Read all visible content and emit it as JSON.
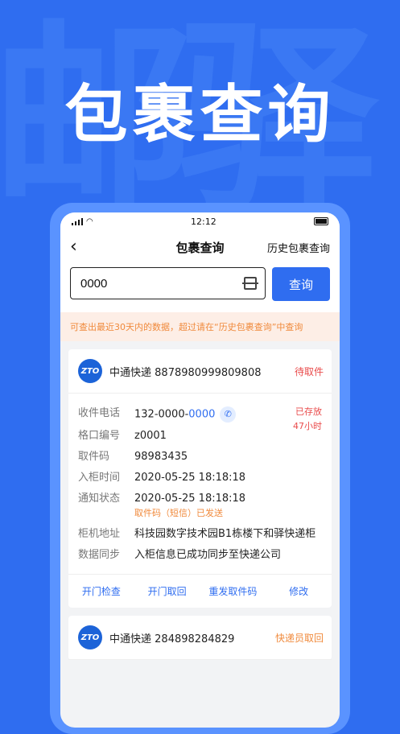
{
  "background": {
    "watermark": "邮驿",
    "hero_title": "包裹查询"
  },
  "status_bar": {
    "time": "12:12"
  },
  "nav": {
    "title": "包裹查询",
    "history_link": "历史包裹查询"
  },
  "search": {
    "value": "0000",
    "button_label": "查询"
  },
  "notice": "可查出最近30天内的数据，超过请在“历史包裹查询”中查询",
  "cards": [
    {
      "carrier": "中通快递",
      "tracking": "8878980999809808",
      "status": "待取件",
      "stored_label": "已存放",
      "stored_duration": "47小时",
      "rows": {
        "phone_label": "收件电话",
        "phone_prefix": "132-0000-",
        "phone_suffix": "0000",
        "slot_label": "格口编号",
        "slot_value": "z0001",
        "code_label": "取件码",
        "code_value": "98983435",
        "in_label": "入柜时间",
        "in_value": "2020-05-25 18:18:18",
        "notify_label": "通知状态",
        "notify_value": "2020-05-25 18:18:18",
        "notify_sub": "取件码（短信）已发送",
        "addr_label": "柜机地址",
        "addr_value": "科技园数字技术园B1栋楼下和驿快递柜",
        "sync_label": "数据同步",
        "sync_value": "入柜信息已成功同步至快递公司"
      },
      "actions": [
        "开门检查",
        "开门取回",
        "重发取件码",
        "修改"
      ]
    },
    {
      "carrier": "中通快递",
      "tracking": "284898284829",
      "status": "快递员取回"
    }
  ],
  "colors": {
    "accent": "#2f6df0",
    "danger": "#e94b4b",
    "warning": "#f08a3c"
  }
}
